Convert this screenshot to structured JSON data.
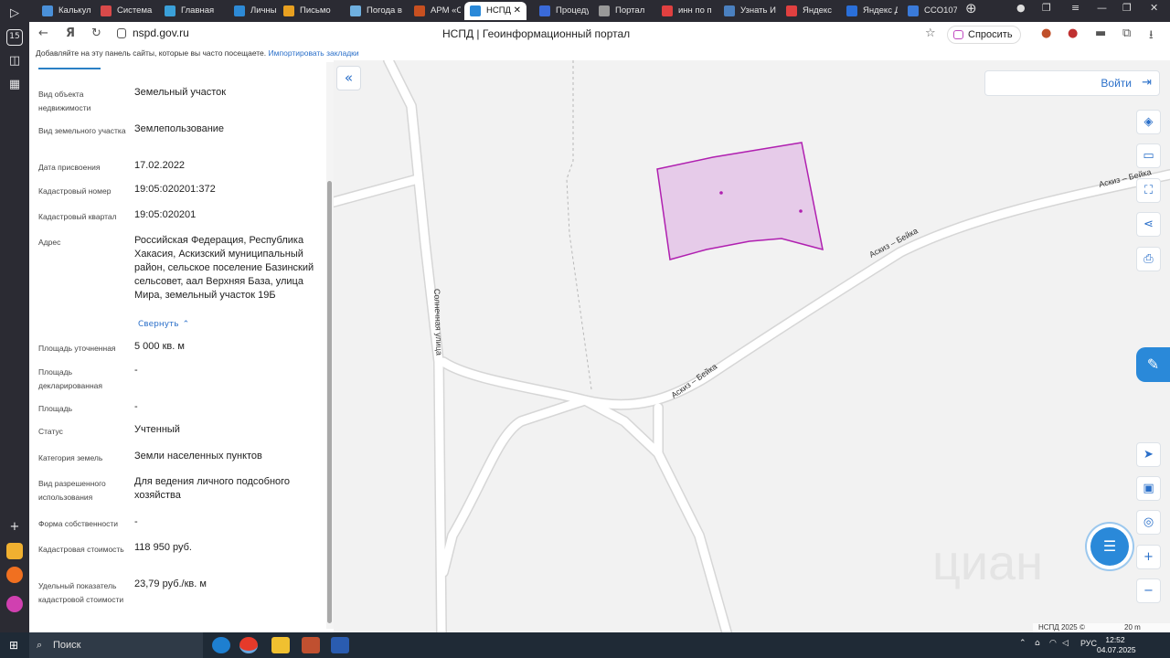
{
  "browser": {
    "tabs": [
      {
        "label": "Калькул",
        "color": "#4a90d9"
      },
      {
        "label": "Система",
        "color": "#d94a4a"
      },
      {
        "label": "Главная",
        "color": "#3aa0d9"
      },
      {
        "label": "Личный",
        "color": "#2d8ad6"
      },
      {
        "label": "Письмо",
        "color": "#e8a020"
      },
      {
        "label": "Погода в",
        "color": "#6fb0e0"
      },
      {
        "label": "АРМ «Сл",
        "color": "#c85020"
      },
      {
        "label": "НСПД",
        "color": "#2a89d9",
        "active": true
      },
      {
        "label": "Процеду",
        "color": "#3a6ad9"
      },
      {
        "label": "Портал",
        "color": "#999999"
      },
      {
        "label": "инн по п",
        "color": "#e04040"
      },
      {
        "label": "Узнать И",
        "color": "#4a80c0"
      },
      {
        "label": "Яндекс",
        "color": "#e04040"
      },
      {
        "label": "Яндекс Д",
        "color": "#2a6fd9"
      },
      {
        "label": "CCО1072",
        "color": "#3a7ad9"
      }
    ],
    "sidebar_badge": "15",
    "url": "nspd.gov.ru",
    "page_title": "НСПД | Геоинформационный портал",
    "ask_label": "Спросить",
    "bookmarks_hint": "Добавляйте на эту панель сайты, которые вы часто посещаете.",
    "bookmarks_import": "Импортировать закладки"
  },
  "panel": {
    "rows": [
      {
        "label": "Вид объекта недвижимости",
        "value": "Земельный участок"
      },
      {
        "label": "Вид земельного участка",
        "value": "Землепользование"
      },
      {
        "label": "Дата присвоения",
        "value": "17.02.2022"
      },
      {
        "label": "Кадастровый номер",
        "value": "19:05:020201:372"
      },
      {
        "label": "Кадастровый квартал",
        "value": "19:05:020201"
      },
      {
        "label": "Адрес",
        "value": "Российская Федерация, Республика Хакасия, Аскизский муниципальный район, сельское поселение Базинский сельсовет, аал Верхняя База, улица Мира, земельный участок 19Б"
      },
      {
        "label": "Площадь уточненная",
        "value": "5 000 кв. м"
      },
      {
        "label": "Площадь декларированная",
        "value": "-"
      },
      {
        "label": "Площадь",
        "value": "-"
      },
      {
        "label": "Статус",
        "value": "Учтенный"
      },
      {
        "label": "Категория земель",
        "value": "Земли населенных пунктов"
      },
      {
        "label": "Вид разрешенного использования",
        "value": "Для ведения личного подсобного хозяйства"
      },
      {
        "label": "Форма собственности",
        "value": "-"
      },
      {
        "label": "Кадастровая стоимость",
        "value": "118 950 руб."
      },
      {
        "label": "Удельный показатель кадастровой стоимости",
        "value": "23,79 руб./кв. м"
      }
    ],
    "collapse_label": "Свернуть"
  },
  "map": {
    "login_label": "Войти",
    "road_labels": [
      "Солнечная улица",
      "Аскиз – Бейка",
      "Аскиз – Бейка",
      "Аскиз – Бейка"
    ],
    "parcel_fill": "#e6cbe9",
    "parcel_stroke": "#b020b0",
    "watermark": "циан",
    "attribution": "НСПД 2025 ©",
    "scale": "20 m"
  },
  "taskbar": {
    "search_label": "Поиск",
    "lang": "РУС",
    "time": "12:52",
    "date": "04.07.2025"
  }
}
